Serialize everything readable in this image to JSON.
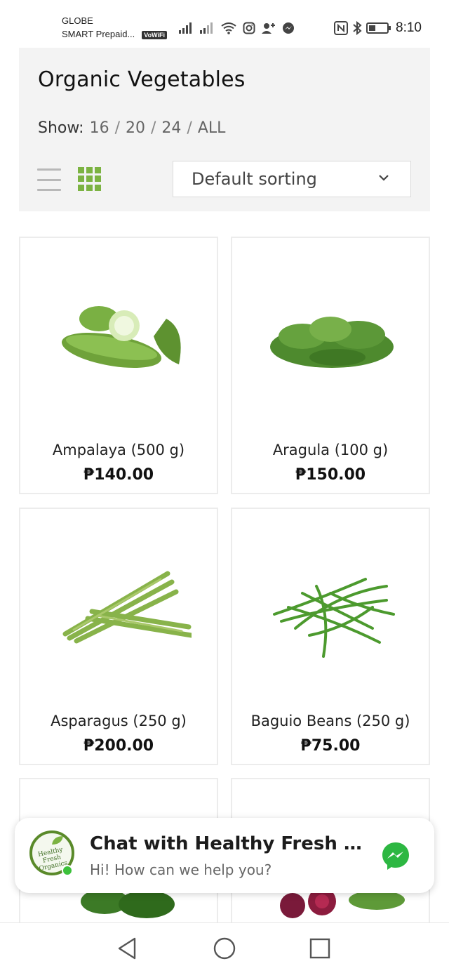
{
  "status_bar": {
    "carrier_1": "GLOBE",
    "carrier_2": "SMART Prepaid...",
    "vowifi": "VoWiFi",
    "time": "8:10"
  },
  "header": {
    "title": "Organic Vegetables",
    "show_label": "Show:",
    "show_options": [
      "16",
      "20",
      "24",
      "ALL"
    ],
    "separator": "/",
    "sort_value": "Default sorting",
    "accent_color": "#7cb342"
  },
  "products": [
    {
      "name": "Ampalaya (500 g)",
      "price": "₱140.00"
    },
    {
      "name": "Aragula (100 g)",
      "price": "₱150.00"
    },
    {
      "name": "Asparagus (250 g)",
      "price": "₱200.00"
    },
    {
      "name": "Baguio Beans (250 g)",
      "price": "₱75.00"
    }
  ],
  "chat": {
    "title": "Chat with Healthy Fresh O...",
    "subtitle": "Hi! How can we help you?",
    "logo_text": "Healthy Fresh Organics",
    "online_color": "#3cc13b",
    "messenger_color": "#2db742"
  },
  "icons": [
    "signal-icon",
    "wifi-icon",
    "instagram-icon",
    "add-contact-icon",
    "messenger-icon",
    "nfc-icon",
    "bluetooth-icon",
    "battery-icon",
    "list-view-icon",
    "grid-view-icon",
    "chevron-down-icon",
    "back-icon",
    "home-icon",
    "recents-icon"
  ]
}
